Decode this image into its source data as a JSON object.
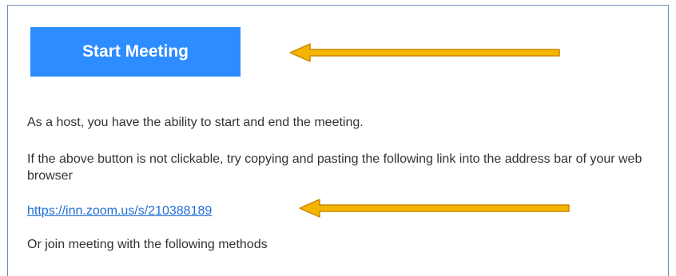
{
  "email": {
    "start_button_label": "Start Meeting",
    "host_text": "As a host, you have the ability to start and end the meeting.",
    "fallback_text": "If the above button is not clickable, try copying and pasting the following link into the address bar of your web browser",
    "meeting_link": "https://inn.zoom.us/s/210388189",
    "join_text": "Or join meeting with the following methods"
  },
  "annotations": {
    "arrow_color": "#f5b400",
    "arrow_outline": "#c98a00",
    "arrow_icon": "left-arrow-icon"
  },
  "colors": {
    "button_bg": "#2d8cff",
    "link": "#1f6fd6",
    "text": "#333333"
  }
}
